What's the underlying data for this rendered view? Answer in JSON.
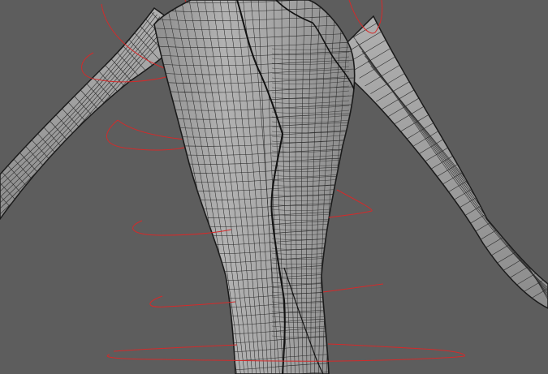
{
  "viewport": {
    "background": "#5d5d5d",
    "mesh_fill": "#a9a9a9",
    "mesh_shade": "#8a8a8a",
    "wire_color": "#222222",
    "curve_color": "#d42a2a",
    "shading_mode": "wireframe-on-shaded"
  },
  "scene": {
    "object": "character-mesh-torso-arms",
    "controls": [
      "neck-circle-control",
      "shoulder-ring-control",
      "chest-ring-control",
      "waist-ring-control",
      "hip-ring-control",
      "pelvis-ring-control"
    ]
  }
}
